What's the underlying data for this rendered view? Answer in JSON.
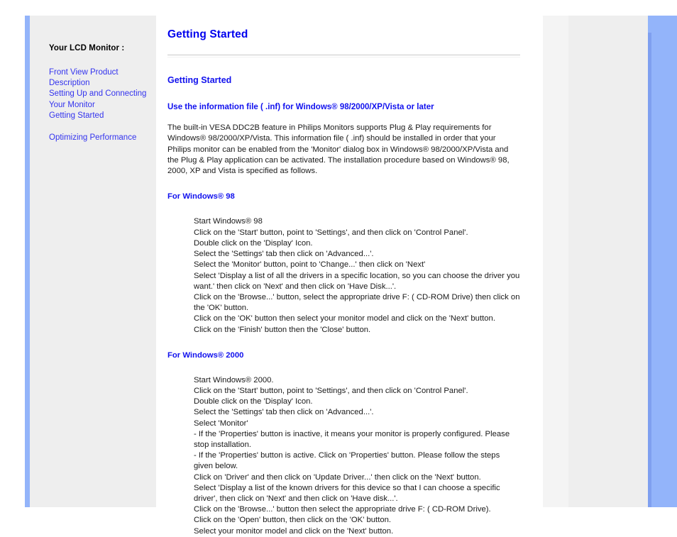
{
  "sidebar": {
    "title": "Your LCD Monitor :",
    "links": [
      "Front View Product",
      "Description",
      "Setting Up and Connecting",
      "Your Monitor",
      "Getting Started"
    ],
    "links_group2": [
      "Optimizing Performance"
    ]
  },
  "main": {
    "page_title": "Getting Started",
    "section_title": "Getting Started",
    "subsection_title": "Use the information file ( .inf) for Windows® 98/2000/XP/Vista or later",
    "intro_paragraph": "The built-in VESA DDC2B feature in Philips Monitors supports Plug & Play requirements for Windows® 98/2000/XP/Vista. This information file ( .inf) should be installed in order that your Philips monitor can be enabled from the 'Monitor' dialog box in Windows® 98/2000/XP/Vista and the Plug & Play application can be activated. The installation procedure based on Windows® 98, 2000, XP and Vista is specified as follows.",
    "win98": {
      "heading": "For Windows® 98",
      "steps": [
        "Start Windows® 98",
        "Click on the 'Start' button, point to 'Settings', and then click on 'Control Panel'.",
        "Double click on the 'Display' Icon.",
        "Select the 'Settings' tab then click on 'Advanced...'.",
        "Select the 'Monitor' button, point to 'Change...' then click on 'Next'",
        "Select 'Display a list of all the drivers in a specific location, so you can choose the driver you want.' then click on 'Next' and then click on 'Have Disk...'.",
        "Click on the 'Browse...' button, select the appropriate drive F: ( CD-ROM Drive) then click on the 'OK' button.",
        "Click on the 'OK' button then select your monitor model and click on the 'Next' button.",
        "Click on the 'Finish' button then the 'Close' button."
      ]
    },
    "win2000": {
      "heading": "For Windows® 2000",
      "steps": [
        "Start Windows® 2000.",
        "Click on the 'Start' button, point to 'Settings', and then click on 'Control Panel'.",
        "Double click on the 'Display' Icon.",
        "Select the 'Settings' tab then click on 'Advanced...'.",
        "Select 'Monitor'",
        "- If the 'Properties' button is inactive, it means your monitor is properly configured. Please stop installation.",
        "- If the 'Properties' button is active. Click on 'Properties' button. Please follow the steps given below.",
        "Click on 'Driver' and then click on 'Update Driver...' then click on the 'Next' button.",
        "Select 'Display a list of the known drivers for this device so that I can choose a specific driver', then click on 'Next' and then click on 'Have disk...'.",
        "Click on the 'Browse...' button then select the appropriate drive F: ( CD-ROM Drive).",
        "Click on the 'Open' button, then click on the 'OK' button.",
        "Select your monitor model and click on the 'Next' button."
      ]
    }
  },
  "colors": {
    "accent_blue": "#0000ee",
    "link_blue": "#3333ee",
    "sidebar_bg": "#eeeeee",
    "band_blue": "#93b4fa"
  }
}
